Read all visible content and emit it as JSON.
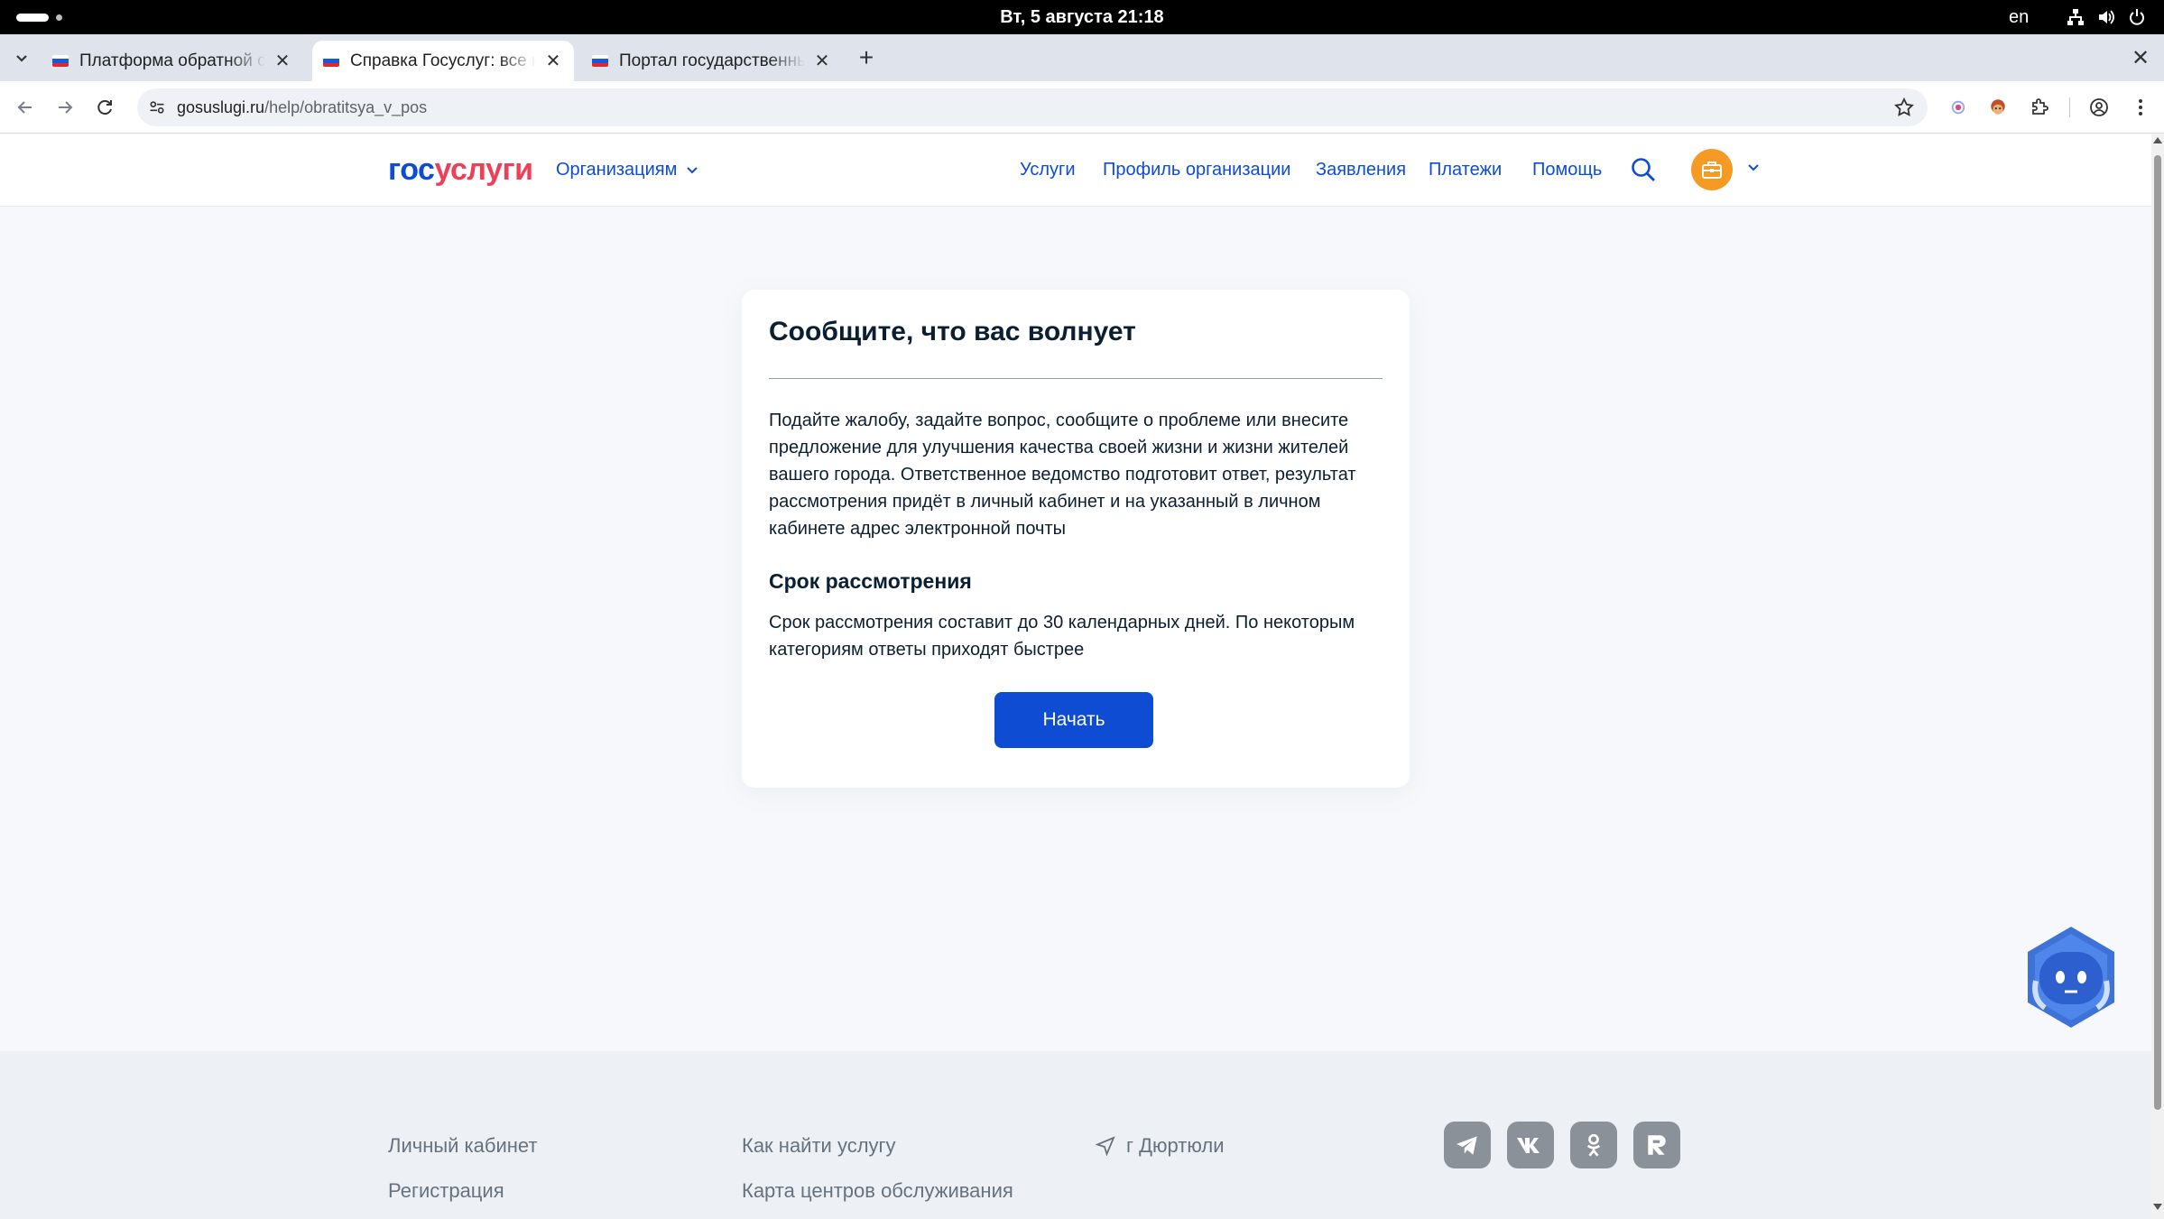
{
  "os": {
    "clock": "Вт, 5 августа  21:18",
    "lang": "en"
  },
  "browser": {
    "tabs": [
      {
        "title": "Платформа обратной связи"
      },
      {
        "title": "Справка Госуслуг: все вопросы"
      },
      {
        "title": "Портал государственных услуг"
      }
    ],
    "url_host": "gosuslugi.ru",
    "url_path": "/help/obratitsya_v_pos"
  },
  "header": {
    "logo_part1": "гос",
    "logo_part2": "услуги",
    "org_menu": "Организациям",
    "nav": [
      "Услуги",
      "Профиль организации",
      "Заявления",
      "Платежи",
      "Помощь"
    ]
  },
  "card": {
    "title": "Сообщите, что вас волнует",
    "text": "Подайте жалобу, задайте вопрос, сообщите о проблеме или внесите предложение для улучшения качества своей жизни и жизни жителей вашего города. Ответственное ведомство подготовит ответ, результат рассмотрения придёт в личный кабинет и на указанный в личном кабинете адрес электронной почты",
    "subtitle": "Срок рассмотрения",
    "text2": "Срок рассмотрения составит до 30 календарных дней. По некоторым категориям ответы приходят быстрее",
    "button": "Начать"
  },
  "footer": {
    "col1": [
      "Личный кабинет",
      "Регистрация"
    ],
    "col2": [
      "Как найти услугу",
      "Карта центров обслуживания"
    ],
    "location": "г Дюртюли"
  },
  "colors": {
    "brand_blue": "#0d4cd3",
    "brand_red": "#ee3f58",
    "accent_orange": "#f59a23"
  }
}
